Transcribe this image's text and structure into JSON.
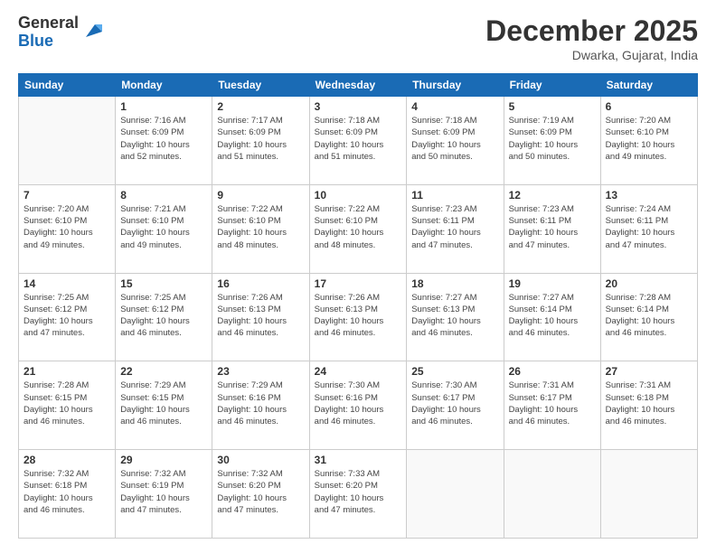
{
  "header": {
    "logo_general": "General",
    "logo_blue": "Blue",
    "month_title": "December 2025",
    "location": "Dwarka, Gujarat, India"
  },
  "days_of_week": [
    "Sunday",
    "Monday",
    "Tuesday",
    "Wednesday",
    "Thursday",
    "Friday",
    "Saturday"
  ],
  "weeks": [
    [
      {
        "day": "",
        "info": ""
      },
      {
        "day": "1",
        "info": "Sunrise: 7:16 AM\nSunset: 6:09 PM\nDaylight: 10 hours\nand 52 minutes."
      },
      {
        "day": "2",
        "info": "Sunrise: 7:17 AM\nSunset: 6:09 PM\nDaylight: 10 hours\nand 51 minutes."
      },
      {
        "day": "3",
        "info": "Sunrise: 7:18 AM\nSunset: 6:09 PM\nDaylight: 10 hours\nand 51 minutes."
      },
      {
        "day": "4",
        "info": "Sunrise: 7:18 AM\nSunset: 6:09 PM\nDaylight: 10 hours\nand 50 minutes."
      },
      {
        "day": "5",
        "info": "Sunrise: 7:19 AM\nSunset: 6:09 PM\nDaylight: 10 hours\nand 50 minutes."
      },
      {
        "day": "6",
        "info": "Sunrise: 7:20 AM\nSunset: 6:10 PM\nDaylight: 10 hours\nand 49 minutes."
      }
    ],
    [
      {
        "day": "7",
        "info": "Sunrise: 7:20 AM\nSunset: 6:10 PM\nDaylight: 10 hours\nand 49 minutes."
      },
      {
        "day": "8",
        "info": "Sunrise: 7:21 AM\nSunset: 6:10 PM\nDaylight: 10 hours\nand 49 minutes."
      },
      {
        "day": "9",
        "info": "Sunrise: 7:22 AM\nSunset: 6:10 PM\nDaylight: 10 hours\nand 48 minutes."
      },
      {
        "day": "10",
        "info": "Sunrise: 7:22 AM\nSunset: 6:10 PM\nDaylight: 10 hours\nand 48 minutes."
      },
      {
        "day": "11",
        "info": "Sunrise: 7:23 AM\nSunset: 6:11 PM\nDaylight: 10 hours\nand 47 minutes."
      },
      {
        "day": "12",
        "info": "Sunrise: 7:23 AM\nSunset: 6:11 PM\nDaylight: 10 hours\nand 47 minutes."
      },
      {
        "day": "13",
        "info": "Sunrise: 7:24 AM\nSunset: 6:11 PM\nDaylight: 10 hours\nand 47 minutes."
      }
    ],
    [
      {
        "day": "14",
        "info": "Sunrise: 7:25 AM\nSunset: 6:12 PM\nDaylight: 10 hours\nand 47 minutes."
      },
      {
        "day": "15",
        "info": "Sunrise: 7:25 AM\nSunset: 6:12 PM\nDaylight: 10 hours\nand 46 minutes."
      },
      {
        "day": "16",
        "info": "Sunrise: 7:26 AM\nSunset: 6:13 PM\nDaylight: 10 hours\nand 46 minutes."
      },
      {
        "day": "17",
        "info": "Sunrise: 7:26 AM\nSunset: 6:13 PM\nDaylight: 10 hours\nand 46 minutes."
      },
      {
        "day": "18",
        "info": "Sunrise: 7:27 AM\nSunset: 6:13 PM\nDaylight: 10 hours\nand 46 minutes."
      },
      {
        "day": "19",
        "info": "Sunrise: 7:27 AM\nSunset: 6:14 PM\nDaylight: 10 hours\nand 46 minutes."
      },
      {
        "day": "20",
        "info": "Sunrise: 7:28 AM\nSunset: 6:14 PM\nDaylight: 10 hours\nand 46 minutes."
      }
    ],
    [
      {
        "day": "21",
        "info": "Sunrise: 7:28 AM\nSunset: 6:15 PM\nDaylight: 10 hours\nand 46 minutes."
      },
      {
        "day": "22",
        "info": "Sunrise: 7:29 AM\nSunset: 6:15 PM\nDaylight: 10 hours\nand 46 minutes."
      },
      {
        "day": "23",
        "info": "Sunrise: 7:29 AM\nSunset: 6:16 PM\nDaylight: 10 hours\nand 46 minutes."
      },
      {
        "day": "24",
        "info": "Sunrise: 7:30 AM\nSunset: 6:16 PM\nDaylight: 10 hours\nand 46 minutes."
      },
      {
        "day": "25",
        "info": "Sunrise: 7:30 AM\nSunset: 6:17 PM\nDaylight: 10 hours\nand 46 minutes."
      },
      {
        "day": "26",
        "info": "Sunrise: 7:31 AM\nSunset: 6:17 PM\nDaylight: 10 hours\nand 46 minutes."
      },
      {
        "day": "27",
        "info": "Sunrise: 7:31 AM\nSunset: 6:18 PM\nDaylight: 10 hours\nand 46 minutes."
      }
    ],
    [
      {
        "day": "28",
        "info": "Sunrise: 7:32 AM\nSunset: 6:18 PM\nDaylight: 10 hours\nand 46 minutes."
      },
      {
        "day": "29",
        "info": "Sunrise: 7:32 AM\nSunset: 6:19 PM\nDaylight: 10 hours\nand 47 minutes."
      },
      {
        "day": "30",
        "info": "Sunrise: 7:32 AM\nSunset: 6:20 PM\nDaylight: 10 hours\nand 47 minutes."
      },
      {
        "day": "31",
        "info": "Sunrise: 7:33 AM\nSunset: 6:20 PM\nDaylight: 10 hours\nand 47 minutes."
      },
      {
        "day": "",
        "info": ""
      },
      {
        "day": "",
        "info": ""
      },
      {
        "day": "",
        "info": ""
      }
    ]
  ]
}
